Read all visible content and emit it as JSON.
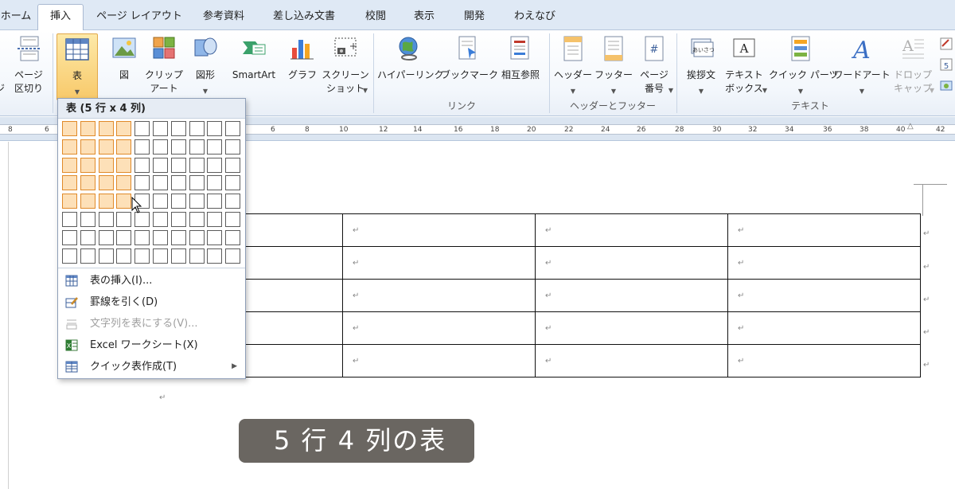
{
  "tabs": [
    {
      "label": "ホーム",
      "active": false
    },
    {
      "label": "挿入",
      "active": true
    },
    {
      "label": "ページ レイアウト",
      "active": false
    },
    {
      "label": "参考資料",
      "active": false
    },
    {
      "label": "差し込み文書",
      "active": false
    },
    {
      "label": "校閲",
      "active": false
    },
    {
      "label": "表示",
      "active": false
    },
    {
      "label": "開発",
      "active": false
    },
    {
      "label": "わえなび",
      "active": false
    }
  ],
  "ribbon": {
    "page_break": {
      "line1": "ページ",
      "line2": "区切り"
    },
    "table": {
      "label": "表"
    },
    "picture": {
      "label": "図"
    },
    "clipart": {
      "line1": "クリップ",
      "line2": "アート"
    },
    "shapes": {
      "label": "図形"
    },
    "smartart": {
      "label": "SmartArt"
    },
    "chart": {
      "label": "グラフ"
    },
    "screenshot": {
      "line1": "スクリーン",
      "line2": "ショット"
    },
    "hyperlink": {
      "label": "ハイパーリンク"
    },
    "bookmark": {
      "label": "ブックマーク"
    },
    "crossref": {
      "label": "相互参照"
    },
    "header": {
      "label": "ヘッダー"
    },
    "footer": {
      "label": "フッター"
    },
    "page_number": {
      "line1": "ページ",
      "line2": "番号"
    },
    "greeting": {
      "label": "挨拶文"
    },
    "textbox": {
      "line1": "テキスト",
      "line2": "ボックス"
    },
    "quickparts": {
      "label": "クイック パーツ"
    },
    "wordart": {
      "label": "ワードアート"
    },
    "dropcap": {
      "line1": "ドロップ",
      "line2": "キャップ"
    },
    "groups": {
      "link": "リンク",
      "header_footer": "ヘッダーとフッター",
      "text": "テキスト"
    }
  },
  "ruler": {
    "labels": [
      "8",
      "6",
      "6",
      "8",
      "10",
      "12",
      "14",
      "16",
      "18",
      "20",
      "22",
      "24",
      "26",
      "28",
      "30",
      "32",
      "34",
      "36",
      "38",
      "40",
      "42"
    ]
  },
  "dropdown": {
    "title": "表 (5 行 x 4 列)",
    "grid_cols": 10,
    "grid_rows": 8,
    "selected_cols": 4,
    "selected_rows": 5,
    "items": [
      {
        "label": "表の挿入(I)...",
        "icon": "table-insert-icon",
        "disabled": false
      },
      {
        "label": "罫線を引く(D)",
        "icon": "draw-table-icon",
        "disabled": false
      },
      {
        "label": "文字列を表にする(V)...",
        "icon": "convert-text-icon",
        "disabled": true
      },
      {
        "label": "Excel ワークシート(X)",
        "icon": "excel-icon",
        "disabled": false
      },
      {
        "label": "クイック表作成(T)",
        "icon": "quick-table-icon",
        "disabled": false,
        "submenu": true
      }
    ]
  },
  "document": {
    "mark": "↵"
  },
  "caption": "5 行 4 列の表",
  "colors": {
    "accent": "#f8c96a",
    "grid_highlight": "#fde0b8",
    "grid_highlight_border": "#e08a2a",
    "caption_bg": "#6a6661"
  }
}
